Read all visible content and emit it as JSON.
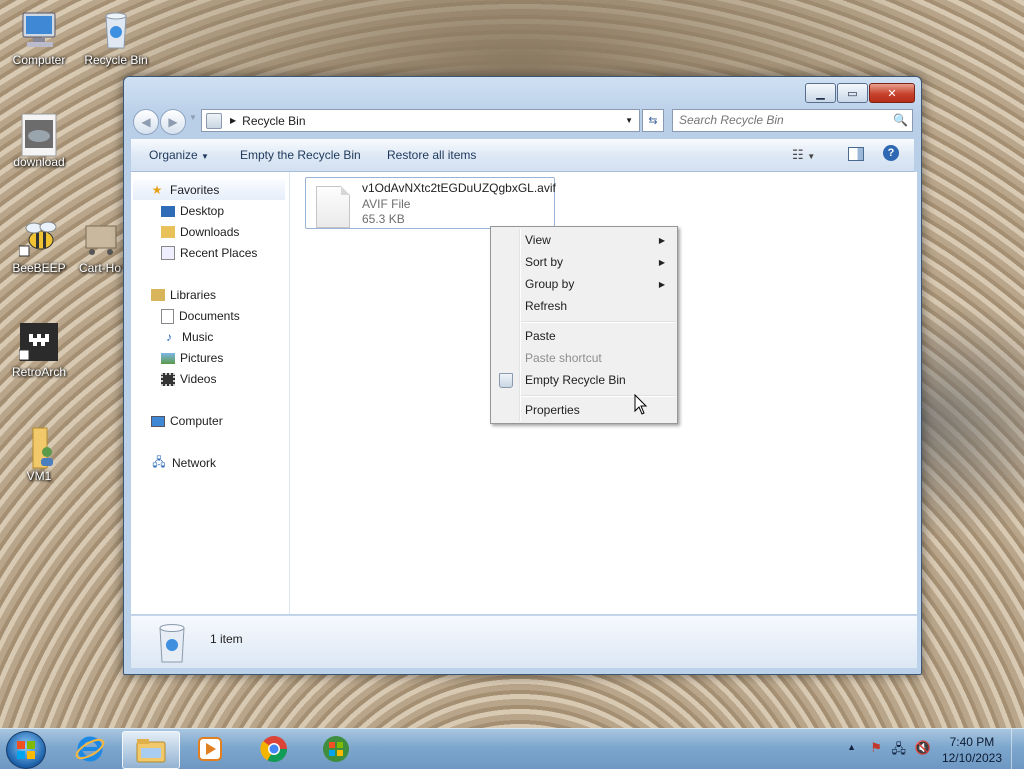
{
  "desktop": {
    "icons": [
      {
        "label": "Computer"
      },
      {
        "label": "Recycle Bin"
      },
      {
        "label": "download"
      },
      {
        "label": "BeeBEEP"
      },
      {
        "label": "Cart-Ho"
      },
      {
        "label": "RetroArch"
      },
      {
        "label": "VM1"
      }
    ]
  },
  "window": {
    "address": {
      "crumb": "Recycle Bin"
    },
    "search": {
      "placeholder": "Search Recycle Bin"
    },
    "toolbar": {
      "organize": "Organize",
      "empty": "Empty the Recycle Bin",
      "restore": "Restore all items"
    },
    "nav": {
      "favorites": "Favorites",
      "desktop": "Desktop",
      "downloads": "Downloads",
      "recent": "Recent Places",
      "libraries": "Libraries",
      "documents": "Documents",
      "music": "Music",
      "pictures": "Pictures",
      "videos": "Videos",
      "computer": "Computer",
      "network": "Network"
    },
    "file": {
      "name": "v1OdAvNXtc2tEGDuUZQgbxGL.avif",
      "type": "AVIF File",
      "size": "65.3 KB"
    },
    "status": {
      "text": "1 item"
    }
  },
  "context_menu": {
    "view": "View",
    "sort_by": "Sort by",
    "group_by": "Group by",
    "refresh": "Refresh",
    "paste": "Paste",
    "paste_shortcut": "Paste shortcut",
    "empty_bin": "Empty Recycle Bin",
    "properties": "Properties"
  },
  "taskbar": {
    "clock": {
      "time": "7:40 PM",
      "date": "12/10/2023"
    }
  }
}
